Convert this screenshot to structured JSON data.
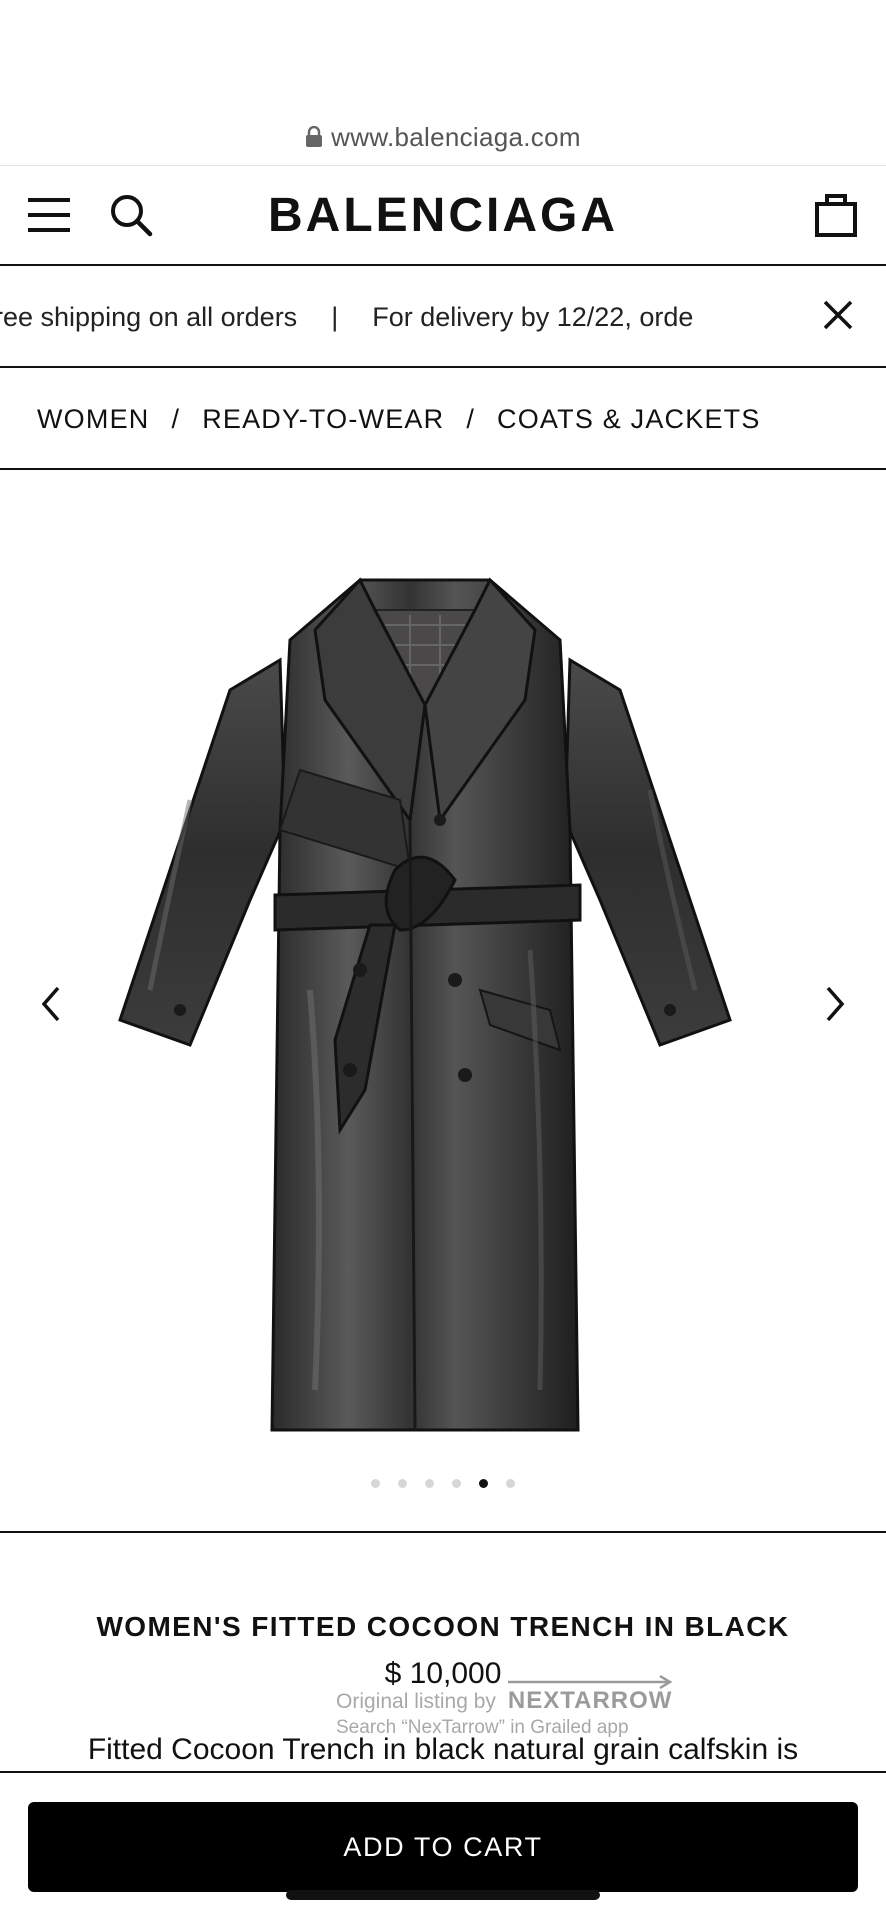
{
  "browser": {
    "url": "www.balenciaga.com",
    "lock_icon": "lock-icon"
  },
  "header": {
    "menu_icon": "hamburger-menu-icon",
    "search_icon": "search-icon",
    "brand": "BALENCIAGA",
    "bag_icon": "shopping-bag-icon"
  },
  "promo": {
    "items": [
      "ree shipping on all orders",
      "|",
      "For delivery by 12/22, orde"
    ],
    "close_icon": "close-icon"
  },
  "breadcrumb": {
    "items": [
      "WOMEN",
      "READY-TO-WEAR",
      "COATS & JACKETS"
    ],
    "separator": "/"
  },
  "gallery": {
    "image": "black-leather-trench-coat",
    "prev_icon": "chevron-left-icon",
    "next_icon": "chevron-right-icon",
    "slide_count": 6,
    "active_slide": 5
  },
  "product": {
    "name": "WOMEN'S FITTED COCOON TRENCH IN BLACK",
    "price": "$ 10,000",
    "description": "Fitted Cocoon Trench in black natural grain calfskin is"
  },
  "watermark": {
    "line1": "Original listing by",
    "brand": "NEXTARROW",
    "line2": "Search “NexTarrow” in Grailed app"
  },
  "cart": {
    "label": "ADD TO CART"
  }
}
